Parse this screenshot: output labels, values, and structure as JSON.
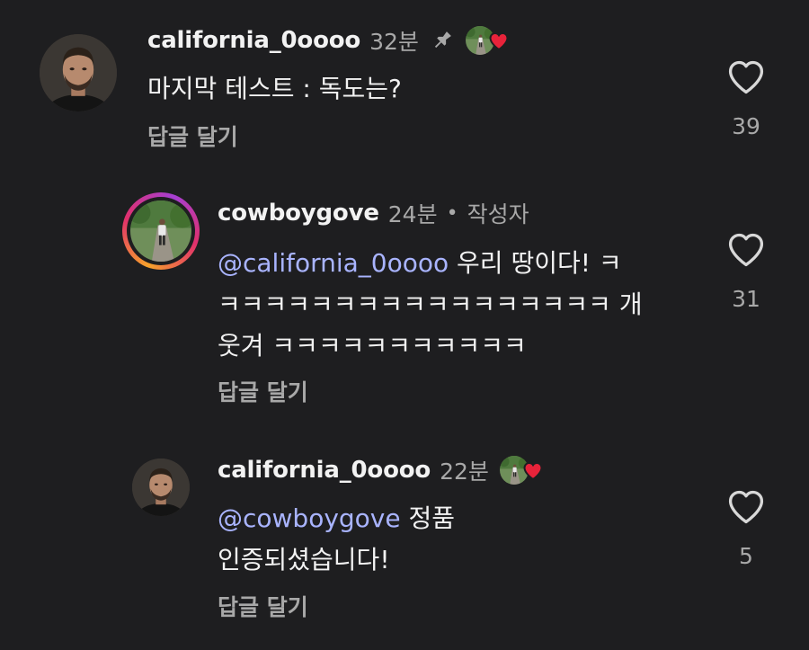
{
  "colors": {
    "background": "#1e1e20",
    "mention": "#a9b4ff",
    "muted": "#a8a8a8",
    "heart_red": "#e8233a"
  },
  "comments": [
    {
      "username": "california_0oooo",
      "time": "32분",
      "pinned": true,
      "liked_by_author": true,
      "text": "마지막 테스트 : 독도는?",
      "reply_label": "답글 달기",
      "like_count": "39"
    },
    {
      "username": "cowboygove",
      "time": "24분",
      "dot": "•",
      "author_tag": "작성자",
      "mention": "@california_0oooo",
      "text_line1": " 우리 땅이다!  ㅋ",
      "text_line2": "ㅋㅋㅋㅋㅋㅋㅋㅋㅋㅋㅋㅋㅋㅋㅋㅋㅋ 개",
      "text_line3": "웃겨 ㅋㅋㅋㅋㅋㅋㅋㅋㅋㅋㅋ",
      "reply_label": "답글 달기",
      "like_count": "31"
    },
    {
      "username": "california_0oooo",
      "time": "22분",
      "liked_by_author": true,
      "mention": "@cowboygove",
      "text_line1": " 정품",
      "text_line2": "인증되셨습니다!",
      "reply_label": "답글 달기",
      "like_count": "5"
    }
  ]
}
